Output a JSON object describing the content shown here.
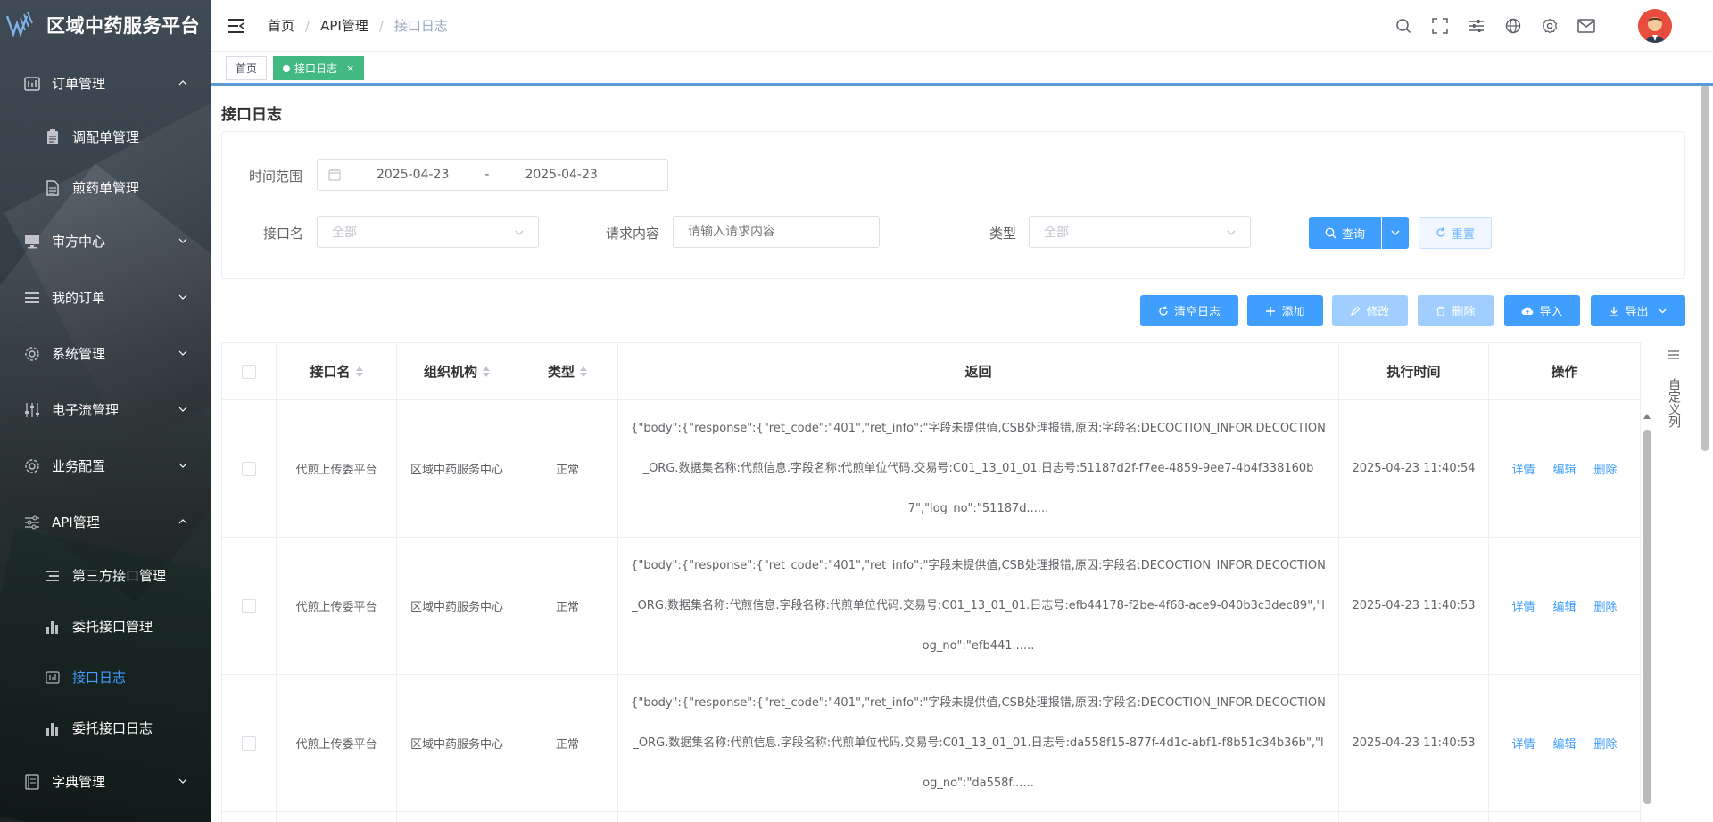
{
  "app": {
    "title": "区域中药服务平台"
  },
  "sidebar": {
    "items": [
      {
        "label": "订单管理",
        "icon": "dashboard-icon",
        "expanded": true
      },
      {
        "label": "调配单管理",
        "icon": "clipboard-icon"
      },
      {
        "label": "煎药单管理",
        "icon": "document-icon"
      },
      {
        "label": "审方中心",
        "icon": "monitor-icon"
      },
      {
        "label": "我的订单",
        "icon": "list-icon"
      },
      {
        "label": "系统管理",
        "icon": "gear-icon"
      },
      {
        "label": "电子流管理",
        "icon": "sliders-icon"
      },
      {
        "label": "业务配置",
        "icon": "gear-icon"
      },
      {
        "label": "API管理",
        "icon": "adjust-icon",
        "expanded": true
      },
      {
        "label": "第三方接口管理",
        "icon": "list-icon"
      },
      {
        "label": "委托接口管理",
        "icon": "bar-chart-icon"
      },
      {
        "label": "接口日志",
        "icon": "dashboard-icon",
        "active": true
      },
      {
        "label": "委托接口日志",
        "icon": "bar-chart-icon"
      },
      {
        "label": "字典管理",
        "icon": "book-icon"
      }
    ]
  },
  "header": {
    "breadcrumb": [
      "首页",
      "API管理",
      "接口日志"
    ],
    "icons": [
      "search-icon",
      "fullscreen-icon",
      "settings-sliders-icon",
      "globe-icon",
      "gear-icon",
      "mail-icon"
    ]
  },
  "tags": {
    "home": "首页",
    "active": "接口日志",
    "close": "×"
  },
  "page": {
    "title": "接口日志"
  },
  "filter": {
    "time_range_label": "时间范围",
    "date_start": "2025-04-23",
    "date_sep": "-",
    "date_end": "2025-04-23",
    "api_name_label": "接口名",
    "api_name_value": "全部",
    "request_label": "请求内容",
    "request_placeholder": "请输入请求内容",
    "type_label": "类型",
    "type_value": "全部",
    "search_label": "查询",
    "reset_label": "重置"
  },
  "toolbar": {
    "clear_label": "清空日志",
    "add_label": "添加",
    "edit_label": "修改",
    "delete_label": "删除",
    "import_label": "导入",
    "export_label": "导出"
  },
  "table": {
    "columns": [
      "接口名",
      "组织机构",
      "类型",
      "返回",
      "执行时间",
      "操作"
    ],
    "column_settings": "自定义列",
    "actions": [
      "详情",
      "编辑",
      "删除"
    ],
    "rows": [
      {
        "name": "代煎上传委平台",
        "org": "区域中药服务中心",
        "type": "正常",
        "ret": "{\"body\":{\"response\":{\"ret_code\":\"401\",\"ret_info\":\"字段未提供值,CSB处理报错,原因:字段名:DECOCTION_INFOR.DECOCTION_ORG.数据集名称:代煎信息.字段名称:代煎单位代码.交易号:C01_13_01_01.日志号:51187d2f-f7ee-4859-9ee7-4b4f338160b7\",\"log_no\":\"51187d......",
        "time": "2025-04-23 11:40:54"
      },
      {
        "name": "代煎上传委平台",
        "org": "区域中药服务中心",
        "type": "正常",
        "ret": "{\"body\":{\"response\":{\"ret_code\":\"401\",\"ret_info\":\"字段未提供值,CSB处理报错,原因:字段名:DECOCTION_INFOR.DECOCTION_ORG.数据集名称:代煎信息.字段名称:代煎单位代码.交易号:C01_13_01_01.日志号:efb44178-f2be-4f68-ace9-040b3c3dec89\",\"log_no\":\"efb441......",
        "time": "2025-04-23 11:40:53"
      },
      {
        "name": "代煎上传委平台",
        "org": "区域中药服务中心",
        "type": "正常",
        "ret": "{\"body\":{\"response\":{\"ret_code\":\"401\",\"ret_info\":\"字段未提供值,CSB处理报错,原因:字段名:DECOCTION_INFOR.DECOCTION_ORG.数据集名称:代煎信息.字段名称:代煎单位代码.交易号:C01_13_01_01.日志号:da558f15-877f-4d1c-abf1-f8b51c34b36b\",\"log_no\":\"da558f......",
        "time": "2025-04-23 11:40:53"
      }
    ]
  }
}
